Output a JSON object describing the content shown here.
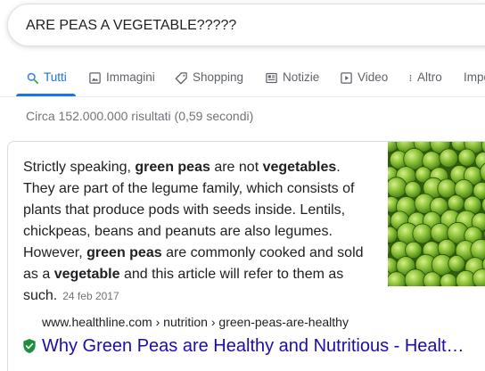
{
  "search": {
    "query": "ARE PEAS A VEGETABLE?????"
  },
  "tabs": [
    {
      "label": "Tutti",
      "icon": "search-icon",
      "active": true
    },
    {
      "label": "Immagini",
      "icon": "image-icon"
    },
    {
      "label": "Shopping",
      "icon": "tag-icon"
    },
    {
      "label": "Notizie",
      "icon": "newspaper-icon"
    },
    {
      "label": "Video",
      "icon": "play-icon"
    },
    {
      "label": "Altro",
      "icon": "more-vertical-icon"
    },
    {
      "label": "Impo",
      "icon": ""
    }
  ],
  "result_stats": "Circa 152.000.000 risultati (0,59 secondi)",
  "featured_snippet": {
    "parts": [
      "Strictly speaking, ",
      "green peas",
      " are not ",
      "vegetables",
      ". They are part of the legume family, which consists of plants that produce pods with seeds inside. Lentils, chickpeas, beans and peanuts are also legumes. However, ",
      "green peas",
      " are commonly cooked and sold as a ",
      "vegetable",
      " and this article will refer to them as such."
    ],
    "date": "24 feb 2017",
    "cite": "www.healthline.com › nutrition › green-peas-are-healthy",
    "title": "Why Green Peas are Healthy and Nutritious - Healthline",
    "image_icon": "green-peas-photo"
  },
  "colors": {
    "accent": "#1a73e8",
    "link": "#1a0dab",
    "secure": "#1e8e3e",
    "muted": "#70757a"
  }
}
